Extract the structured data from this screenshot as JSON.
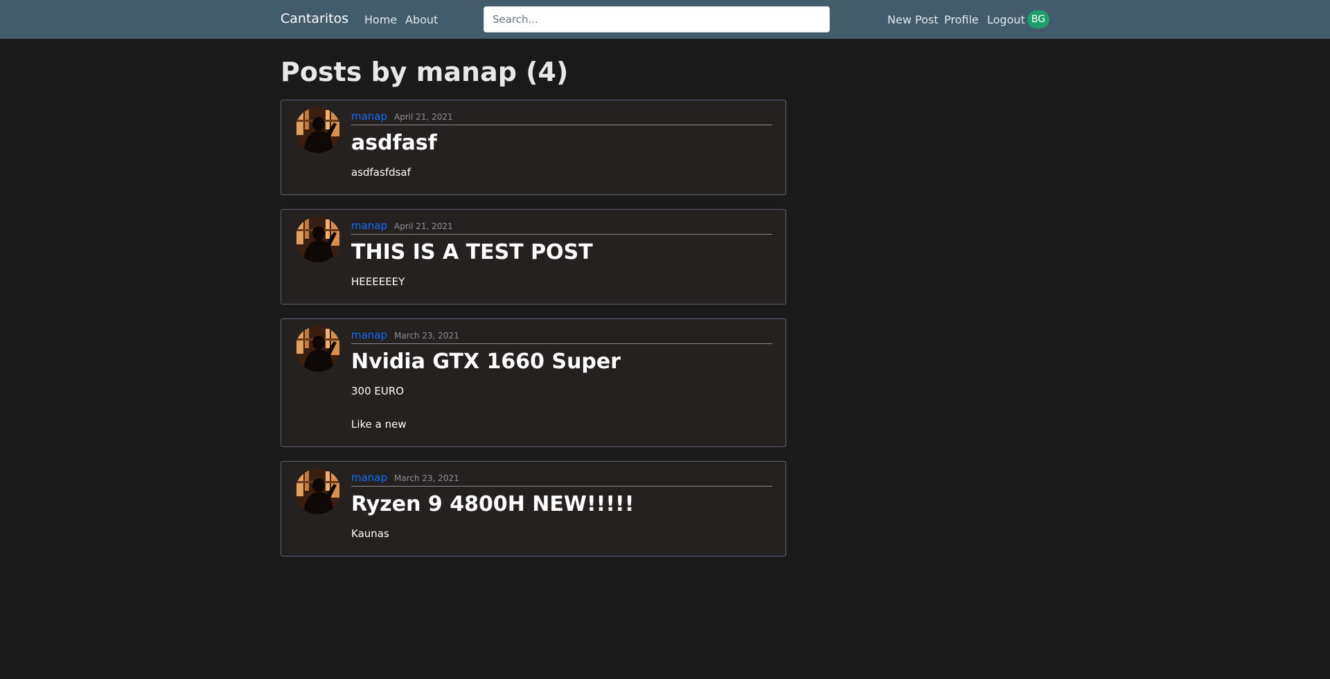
{
  "navbar": {
    "brand": "Cantaritos",
    "links": [
      "Home",
      "About"
    ],
    "search_placeholder": "Search...",
    "right_links": [
      "New Post",
      "Profile",
      "Logout"
    ],
    "user_badge": "BG"
  },
  "page": {
    "title": "Posts by manap (4)"
  },
  "posts": [
    {
      "author": "manap",
      "date": "April 21, 2021",
      "title": "asdfasf",
      "content": "asdfasfdsaf"
    },
    {
      "author": "manap",
      "date": "April 21, 2021",
      "title": "THIS IS A TEST POST",
      "content": "HEEEEEEY"
    },
    {
      "author": "manap",
      "date": "March 23, 2021",
      "title": "Nvidia GTX 1660 Super",
      "content": "300 EURO\n\nLike a new"
    },
    {
      "author": "manap",
      "date": "March 23, 2021",
      "title": "Ryzen 9 4800H NEW!!!!!",
      "content": "Kaunas"
    }
  ],
  "colors": {
    "navbar_bg": "#435c6b",
    "page_bg": "#1a1a1a",
    "card_bg": "#262121",
    "link": "#0d6efd",
    "badge": "#1f9d6b"
  }
}
